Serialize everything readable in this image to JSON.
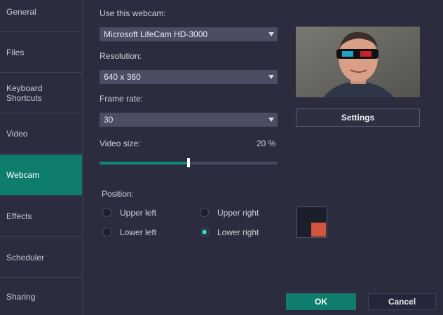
{
  "sidebar": {
    "items": [
      {
        "label": "General"
      },
      {
        "label": "Files"
      },
      {
        "label": "Keyboard\nShortcuts"
      },
      {
        "label": "Video"
      },
      {
        "label": "Webcam"
      },
      {
        "label": "Effects"
      },
      {
        "label": "Scheduler"
      },
      {
        "label": "Sharing"
      }
    ],
    "active": "Webcam"
  },
  "webcam": {
    "label": "Use this webcam:",
    "value": "Microsoft LifeCam HD-3000"
  },
  "resolution": {
    "label": "Resolution:",
    "value": "640 x 360"
  },
  "frame_rate": {
    "label": "Frame rate:",
    "value": "30"
  },
  "video_size": {
    "label": "Video size:",
    "value_text": "20 %",
    "slider_fraction": 0.5
  },
  "position": {
    "label": "Position:",
    "options": {
      "upper_left": "Upper left",
      "upper_right": "Upper right",
      "lower_left": "Lower left",
      "lower_right": "Lower right"
    },
    "selected": "Lower right"
  },
  "settings_button": "Settings",
  "buttons": {
    "ok": "OK",
    "cancel": "Cancel"
  },
  "colors": {
    "accent": "#0f7d6c",
    "radio_selected": "#34d6c0",
    "position_marker": "#d4553d"
  },
  "icons": {
    "dropdown": "chevron-down-icon",
    "preview": "webcam-preview-image"
  }
}
